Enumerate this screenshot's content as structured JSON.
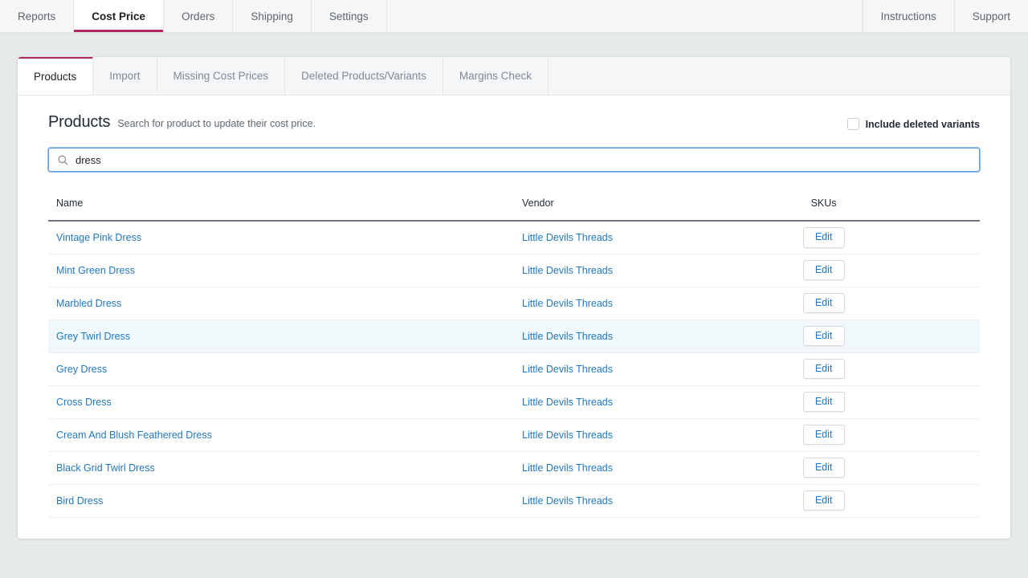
{
  "topnav": {
    "left_items": [
      {
        "label": "Reports",
        "active": false
      },
      {
        "label": "Cost Price",
        "active": true
      },
      {
        "label": "Orders",
        "active": false
      },
      {
        "label": "Shipping",
        "active": false
      },
      {
        "label": "Settings",
        "active": false
      }
    ],
    "right_items": [
      {
        "label": "Instructions"
      },
      {
        "label": "Support"
      }
    ],
    "accent_color": "#b3285f"
  },
  "subtabs": [
    {
      "label": "Products",
      "active": true
    },
    {
      "label": "Import",
      "active": false
    },
    {
      "label": "Missing Cost Prices",
      "active": false
    },
    {
      "label": "Deleted Products/Variants",
      "active": false
    },
    {
      "label": "Margins Check",
      "active": false
    }
  ],
  "header": {
    "title": "Products",
    "subtitle": "Search for product to update their cost price.",
    "checkbox_label": "Include deleted variants",
    "checkbox_checked": false
  },
  "search": {
    "value": "dress",
    "placeholder": "",
    "icon": "search-icon",
    "focused": true
  },
  "table": {
    "columns": [
      "Name",
      "Vendor",
      "SKUs"
    ],
    "action_label": "Edit",
    "rows": [
      {
        "name": "Vintage Pink Dress",
        "vendor": "Little Devils Threads",
        "skus": "",
        "hover": false
      },
      {
        "name": "Mint Green Dress",
        "vendor": "Little Devils Threads",
        "skus": "",
        "hover": false
      },
      {
        "name": "Marbled Dress",
        "vendor": "Little Devils Threads",
        "skus": "",
        "hover": false
      },
      {
        "name": "Grey Twirl Dress",
        "vendor": "Little Devils Threads",
        "skus": "",
        "hover": true
      },
      {
        "name": "Grey Dress",
        "vendor": "Little Devils Threads",
        "skus": "",
        "hover": false
      },
      {
        "name": "Cross Dress",
        "vendor": "Little Devils Threads",
        "skus": "",
        "hover": false
      },
      {
        "name": "Cream And Blush Feathered Dress",
        "vendor": "Little Devils Threads",
        "skus": "",
        "hover": false
      },
      {
        "name": "Black Grid Twirl Dress",
        "vendor": "Little Devils Threads",
        "skus": "",
        "hover": false
      },
      {
        "name": "Bird Dress",
        "vendor": "Little Devils Threads",
        "skus": "",
        "hover": false
      }
    ]
  },
  "colors": {
    "accent": "#b3285f",
    "link": "#1f78c1",
    "row_hover": "#f0f8fb",
    "page_bg": "#e7eaea"
  }
}
